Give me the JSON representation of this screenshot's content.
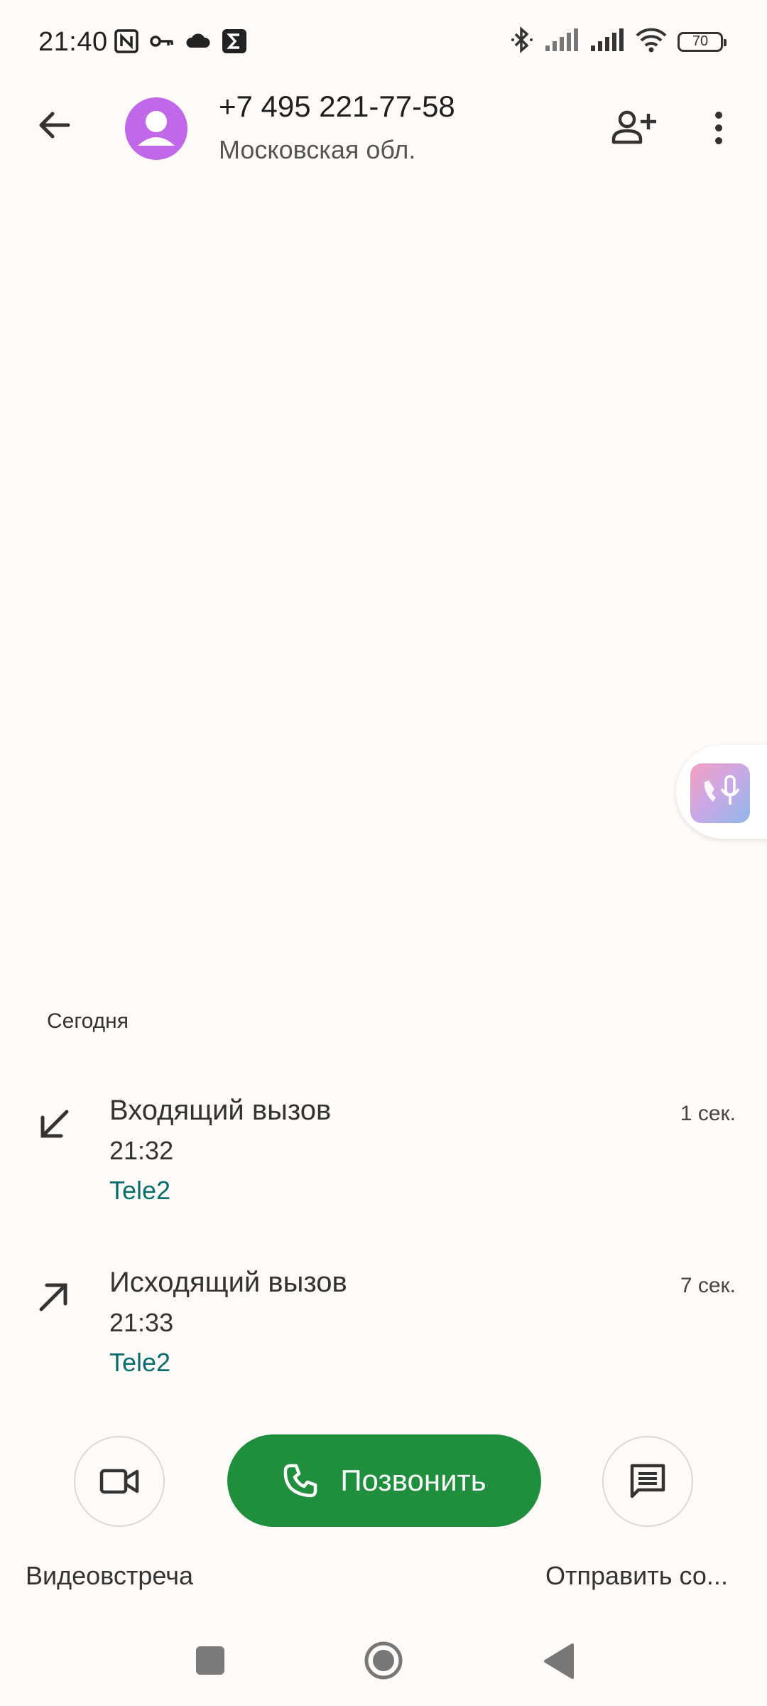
{
  "status_bar": {
    "time": "21:40",
    "battery": "70",
    "left_icons": [
      "nfc-icon",
      "vpn-key-icon",
      "cloud-icon",
      "sigma-icon"
    ],
    "right_icons": [
      "bluetooth-icon",
      "signal-icon",
      "signal-icon",
      "wifi-icon",
      "battery-icon"
    ]
  },
  "header": {
    "phone_number": "+7 495 221-77-58",
    "region": "Московская обл.",
    "avatar_color": "#c168ea"
  },
  "history": {
    "section_label": "Сегодня",
    "calls": [
      {
        "type": "Входящий вызов",
        "time": "21:32",
        "network": "Tele2",
        "duration": "1 сек.",
        "direction": "incoming-arrow-icon"
      },
      {
        "type": "Исходящий вызов",
        "time": "21:33",
        "network": "Tele2",
        "duration": "7 сек.",
        "direction": "outgoing-arrow-icon"
      }
    ]
  },
  "actions": {
    "video_label": "Видеовстреча",
    "call_label": "Позвонить",
    "message_label": "Отправить со...",
    "call_color": "#1f8f3d"
  }
}
